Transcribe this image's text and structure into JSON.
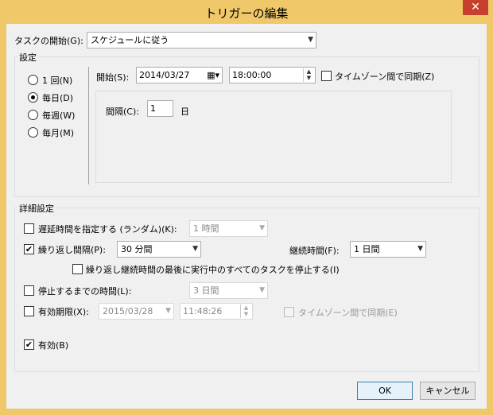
{
  "window": {
    "title": "トリガーの編集",
    "close": "✕"
  },
  "start_task": {
    "label": "タスクの開始(G):",
    "value": "スケジュールに従う"
  },
  "settings": {
    "group_title": "設定",
    "radios": [
      {
        "label": "1 回(N)",
        "selected": false
      },
      {
        "label": "毎日(D)",
        "selected": true
      },
      {
        "label": "毎週(W)",
        "selected": false
      },
      {
        "label": "毎月(M)",
        "selected": false
      }
    ],
    "start_label": "開始(S):",
    "start_date": "2014/03/27",
    "start_time": "18:00:00",
    "tz_sync_label": "タイムゾーン間で同期(Z)",
    "interval_label": "間隔(C):",
    "interval_value": "1",
    "interval_unit": "日"
  },
  "advanced": {
    "group_title": "詳細設定",
    "delay_label": "遅延時間を指定する (ランダム)(K):",
    "delay_value": "1 時間",
    "repeat_label": "繰り返し間隔(P):",
    "repeat_value": "30 分間",
    "duration_label": "継続時間(F):",
    "duration_value": "1 日間",
    "stop_all_label": "繰り返し継続時間の最後に実行中のすべてのタスクを停止する(I)",
    "stop_after_label": "停止するまでの時間(L):",
    "stop_after_value": "3 日間",
    "expire_label": "有効期限(X):",
    "expire_date": "2015/03/28",
    "expire_time": "11:48:26",
    "expire_tz_label": "タイムゾーン間で同期(E)",
    "enabled_label": "有効(B)"
  },
  "buttons": {
    "ok": "OK",
    "cancel": "キャンセル"
  },
  "colors": {
    "frame": "#f0c86a",
    "close": "#c7402d",
    "client": "#f0f0f0"
  }
}
